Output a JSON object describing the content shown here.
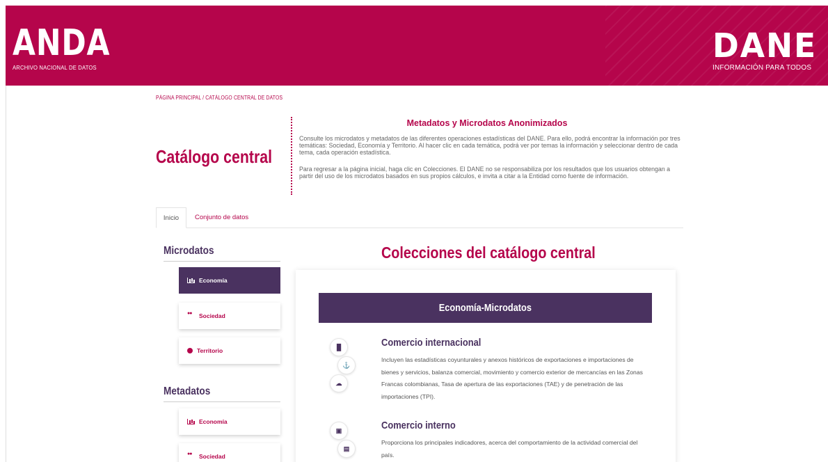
{
  "header": {
    "anda_logo": "ANDA",
    "anda_subtitle": "ARCHIVO NACIONAL DE DATOS",
    "dane_logo": "DANE",
    "dane_subtitle": "INFORMACIÓN PARA TODOS",
    "colors": {
      "brand": "#b5054b",
      "accent": "#4a3260"
    }
  },
  "breadcrumb": {
    "text": "PÁGINA PRINCIPAL / CATÁLOGO CENTRAL DE DATOS"
  },
  "intro": {
    "title": "Catálogo central",
    "heading": "Metadatos y Microdatos Anonimizados",
    "paragraph1": "Consulte los microdatos y metadatos de las diferentes operaciones estadísticas del DANE. Para ello, podrá encontrar la información por tres temáticas: Sociedad, Economía y Territorio. Al hacer clic en cada temática, podrá ver por temas la información y seleccionar dentro de cada tema, cada operación estadística.",
    "paragraph2": "Para regresar a la página inicial, haga clic en Colecciones. El DANE no se responsabiliza por los resultados que los usuarios obtengan a partir del uso de los microdatos basados en sus propios cálculos, e invita a citar a la Entidad como fuente de información."
  },
  "tabs": [
    {
      "label": "Inicio"
    },
    {
      "label": "Conjunto de datos"
    }
  ],
  "sidebar": {
    "microdatos_title": "Microdatos",
    "metadatos_title": "Metadatos",
    "microdatos_items": [
      {
        "label": "Economía",
        "icon": "bar-chart-icon"
      },
      {
        "label": "Sociedad",
        "icon": "users-icon"
      },
      {
        "label": "Territorio",
        "icon": "globe-icon"
      }
    ],
    "metadatos_items": [
      {
        "label": "Economía",
        "icon": "bar-chart-icon"
      },
      {
        "label": "Sociedad",
        "icon": "users-icon"
      }
    ]
  },
  "main": {
    "title": "Colecciones del catálogo central",
    "card_header": "Economía-Microdatos",
    "items": [
      {
        "title": "Comercio internacional",
        "description": "Incluyen las estadísticas coyunturales y anexos históricos de exportaciones e importaciones de bienes y servicios, balanza comercial, movimiento y comercio exterior de mercancías en las Zonas Francas colombianas, Tasa de apertura de las exportaciones (TAE) y de penetración de las importaciones (TPI).",
        "icons": [
          "ilu",
          "ship",
          "map"
        ]
      },
      {
        "title": "Comercio interno",
        "description": "Proporciona los principales indicadores, acerca del comportamiento de la actividad comercial del país.",
        "icons": [
          "car",
          "store"
        ]
      }
    ]
  }
}
